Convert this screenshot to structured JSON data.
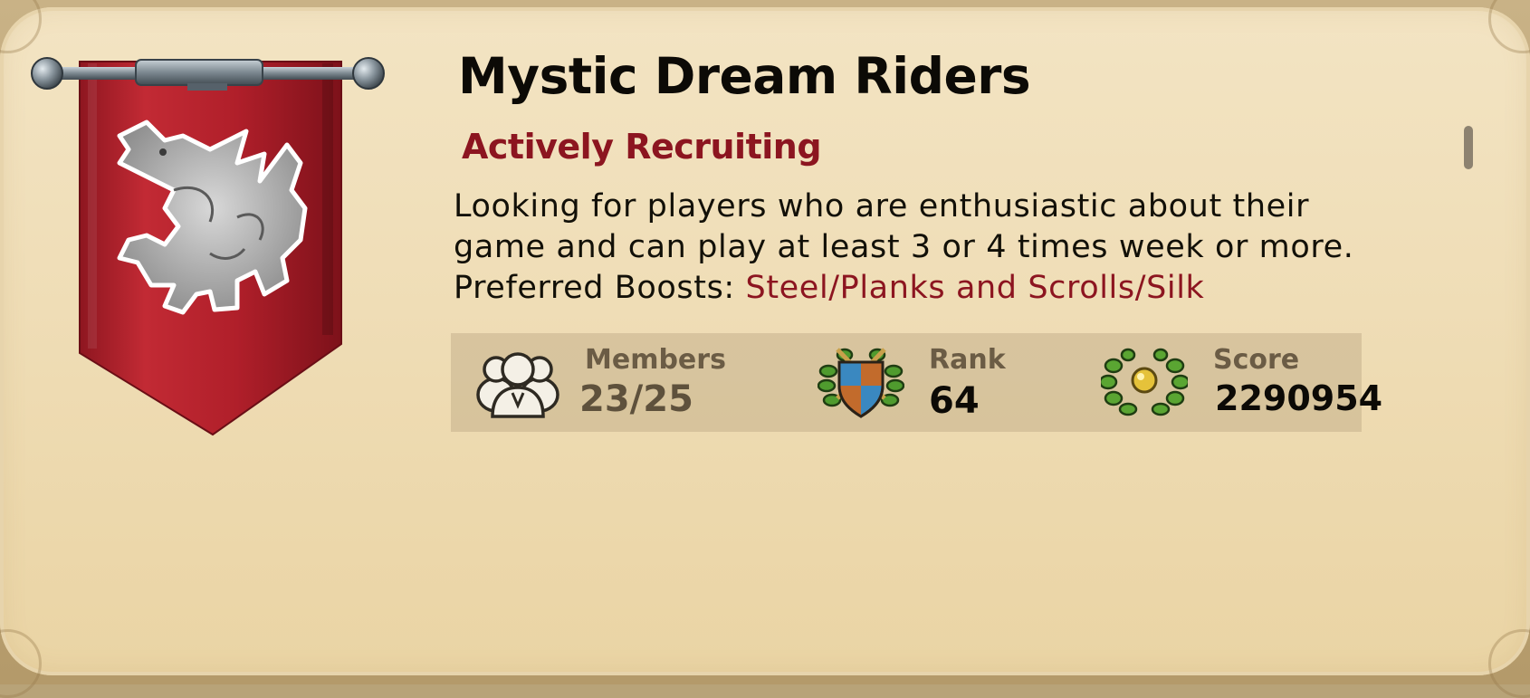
{
  "guild": {
    "name": "Mystic Dream Riders",
    "status": "Actively Recruiting",
    "description_text": "Looking for players who are enthusiastic about their game and can play at least 3 or 4 times week or more. Preferred Boosts: ",
    "boosts": "Steel/Planks and Scrolls/Silk",
    "banner_icon": "dragon-banner-icon"
  },
  "stats": {
    "members": {
      "label": "Members",
      "value": "23/25",
      "icon": "members-icon"
    },
    "rank": {
      "label": "Rank",
      "value": "64",
      "icon": "rank-shield-icon"
    },
    "score": {
      "label": "Score",
      "value": "2290954",
      "icon": "laurel-score-icon"
    }
  },
  "colors": {
    "accent_red": "#8c1520",
    "banner_red": "#b5212d",
    "parchment": "#f0dfb9",
    "text_dark": "#121008",
    "label_brown": "#6b5c45"
  }
}
